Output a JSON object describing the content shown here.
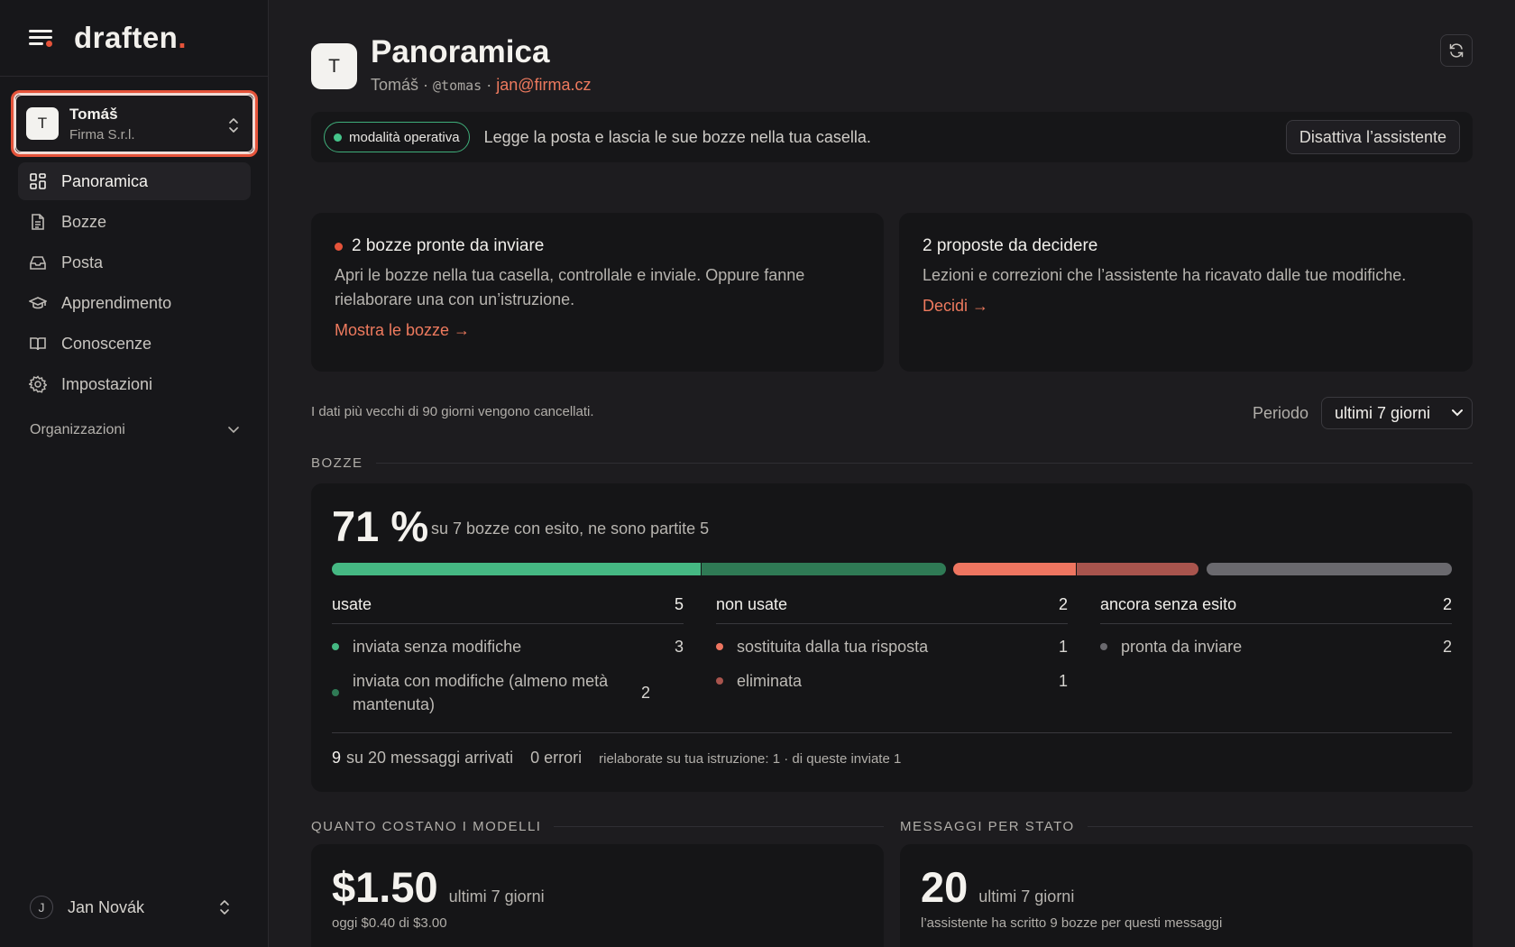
{
  "brand": {
    "name": "draften",
    "dot": "."
  },
  "org": {
    "name": "Tomáš",
    "sub": "Firma S.r.l.",
    "initial": "T"
  },
  "nav": [
    {
      "label": "Panoramica",
      "active": true
    },
    {
      "label": "Bozze"
    },
    {
      "label": "Posta"
    },
    {
      "label": "Apprendimento"
    },
    {
      "label": "Conoscenze"
    },
    {
      "label": "Impostazioni"
    }
  ],
  "org_section": "Organizzazioni",
  "user": {
    "name": "Jan Novák",
    "initial": "J"
  },
  "header": {
    "initial": "T",
    "title": "Panoramica",
    "sub_name": "Tomáš ·",
    "sub_handle": "@tomas",
    "sub_sep": "·",
    "sub_email": "jan@firma.cz"
  },
  "mode": {
    "badge": "modalità operativa",
    "text": "Legge la posta e lascia le sue bozze nella tua casella.",
    "button": "Disattiva l’assistente"
  },
  "tasks": [
    {
      "title": "2 bozze pronte da inviare",
      "desc": "Apri le bozze nella tua casella, controllale e inviale. Oppure fanne rielaborare una con un’istruzione.",
      "link": "Mostra le bozze →"
    },
    {
      "title": "2 proposte da decidere",
      "desc": "Lezioni e correzioni che l’assistente ha ricavato dalle tue modifiche.",
      "link": "Decidi →"
    }
  ],
  "retention": "I dati più vecchi di 90 giorni vengono cancellati.",
  "period": {
    "label": "Periodo",
    "value": "ultimi 7 giorni"
  },
  "bozze": {
    "section": "BOZZE",
    "pct": "71 %",
    "pct_desc": "su 7 bozze con esito, ne sono partite 5",
    "colors": {
      "green": "#45b883",
      "dark_green": "#2f7a55",
      "salmon": "#ee7560",
      "dark_red": "#a8544d",
      "gray": "#6a696e"
    },
    "columns": [
      {
        "title": "usate",
        "count": "5",
        "rows": [
          {
            "label": "inviata senza modifiche",
            "value": "3",
            "color": "#45b883"
          },
          {
            "label": "inviata con modifiche (almeno metà mantenuta)",
            "value": "2",
            "color": "#2f7a55"
          }
        ]
      },
      {
        "title": "non usate",
        "count": "2",
        "rows": [
          {
            "label": "sostituita dalla tua risposta",
            "value": "1",
            "color": "#ee7560"
          },
          {
            "label": "eliminata",
            "value": "1",
            "color": "#a8544d"
          }
        ]
      },
      {
        "title": "ancora senza esito",
        "count": "2",
        "rows": [
          {
            "label": "pronta da inviare",
            "value": "2",
            "color": "#6a696e"
          }
        ]
      }
    ],
    "foot": {
      "arrived_num": "9",
      "arrived_text": "su 20 messaggi arrivati",
      "errors": "0 errori",
      "reworked": "rielaborate su tua istruzione: 1 · di queste inviate 1"
    }
  },
  "cost": {
    "section": "QUANTO COSTANO I MODELLI",
    "value": "$1.50",
    "period": "ultimi 7 giorni",
    "sub": "oggi $0.40 di $3.00"
  },
  "messages": {
    "section": "MESSAGGI PER STATO",
    "value": "20",
    "period": "ultimi 7 giorni",
    "sub": "l’assistente ha scritto 9 bozze per questi messaggi"
  }
}
